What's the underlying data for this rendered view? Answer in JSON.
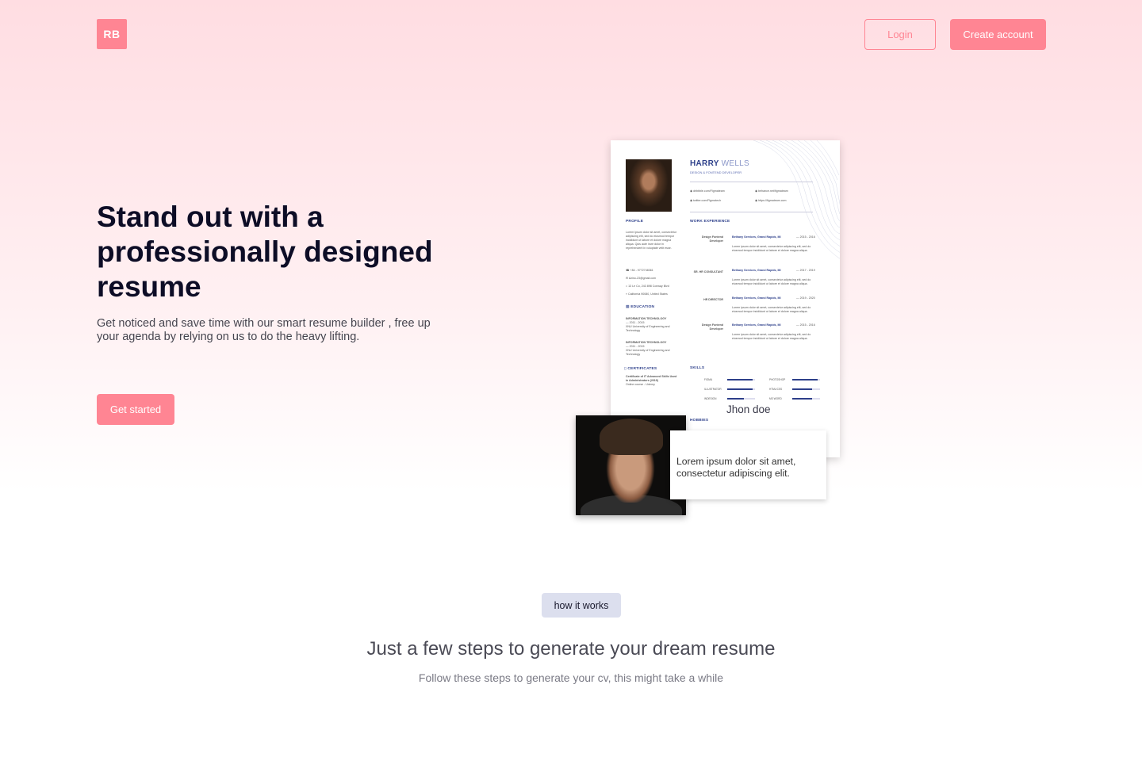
{
  "colors": {
    "accent": "#ff8593",
    "navy": "#2d3f8a",
    "badge_bg": "#dcdfee"
  },
  "header": {
    "logo": "RB",
    "login": "Login",
    "create_account": "Create account"
  },
  "hero": {
    "title": "Stand out with a professionally designed resume",
    "subtitle": "Get noticed and save time with our smart resume builder , free up your agenda by relying on us to do the heavy lifting.",
    "cta": "Get started"
  },
  "resume": {
    "first_name": "HARRY",
    "last_name": "WELLS",
    "role": "DESIGN & FONTEND DEVELOPER",
    "contacts": [
      "dribbble.com/Figmateam",
      "behance.net/figmateam",
      "twitter.com/Figmatech",
      "https://figmateam.com"
    ],
    "profile_title": "PROFILE",
    "profile_text": "Lorem ipsum dolor sit amet, consectetur adipiscing elit, sed do eiusmod tempor incididunt ut labore et dolore magna aliqua. Quis aute irure dolor in reprehenderit in voluptate velit esse.",
    "personal": [
      "+84 - 9772748361",
      "Azino-23@gmail.com",
      "13 Le Co, 243 898 Conway Blvd",
      "California 90080, United States"
    ],
    "education_title": "EDUCATION",
    "education": [
      {
        "title": "INFORMATION TECHNOLOGY",
        "years": "2011 - 2015",
        "school": "XNU University of Engineering and Technology"
      },
      {
        "title": "INFORMATION TECHNOLOGY",
        "years": "2011 - 2015",
        "school": "XNU University of Engineering and Technology"
      }
    ],
    "certificates_title": "CERTIFICATES",
    "certificate": "Certificate of IT Advanced Skills Used in Administrators (2019)",
    "certificate_note": "Online course - Udemy",
    "work_title": "WORK EXPERIENCE",
    "work": [
      {
        "role": "Design Fontend Developer",
        "company": "Bethany Services, Grand Rapids, MI",
        "years": "2015 - 2016"
      },
      {
        "role": "SR. HR CONSULTANT",
        "company": "Bethany Services, Grand Rapids, MI",
        "years": "2017 - 2019"
      },
      {
        "role": "HR DIRECTOR",
        "company": "Bethany Services, Grand Rapids, MI",
        "years": "2019 - 2020"
      },
      {
        "role": "Design Fontend Developer",
        "company": "Bethany Services, Grand Rapids, MI",
        "years": "2015 - 2016"
      }
    ],
    "work_text": "Lorem ipsum dolor sit amet, consectetur adipiscing elit, sed do eiusmod tempor incididunt ut labore et dolore magna aliqua.",
    "skills_title": "SKILLS",
    "skills": [
      {
        "name": "FIGMA",
        "level": 0.9
      },
      {
        "name": "PHOTOSHOP",
        "level": 0.9
      },
      {
        "name": "ILLUSTRATOR",
        "level": 0.9
      },
      {
        "name": "HTML/CSS",
        "level": 0.7
      },
      {
        "name": "INDESIGN",
        "level": 0.6
      },
      {
        "name": "MS WORD",
        "level": 0.7
      }
    ],
    "hobbies_title": "HOBBIES"
  },
  "card": {
    "name": "Jhon doe",
    "quote": "Lorem ipsum dolor sit amet, consectetur adipiscing elit."
  },
  "how": {
    "badge": "how  it works",
    "title": "Just a few steps to generate your dream resume",
    "subtitle": "Follow these steps to generate your cv, this might take a while"
  }
}
